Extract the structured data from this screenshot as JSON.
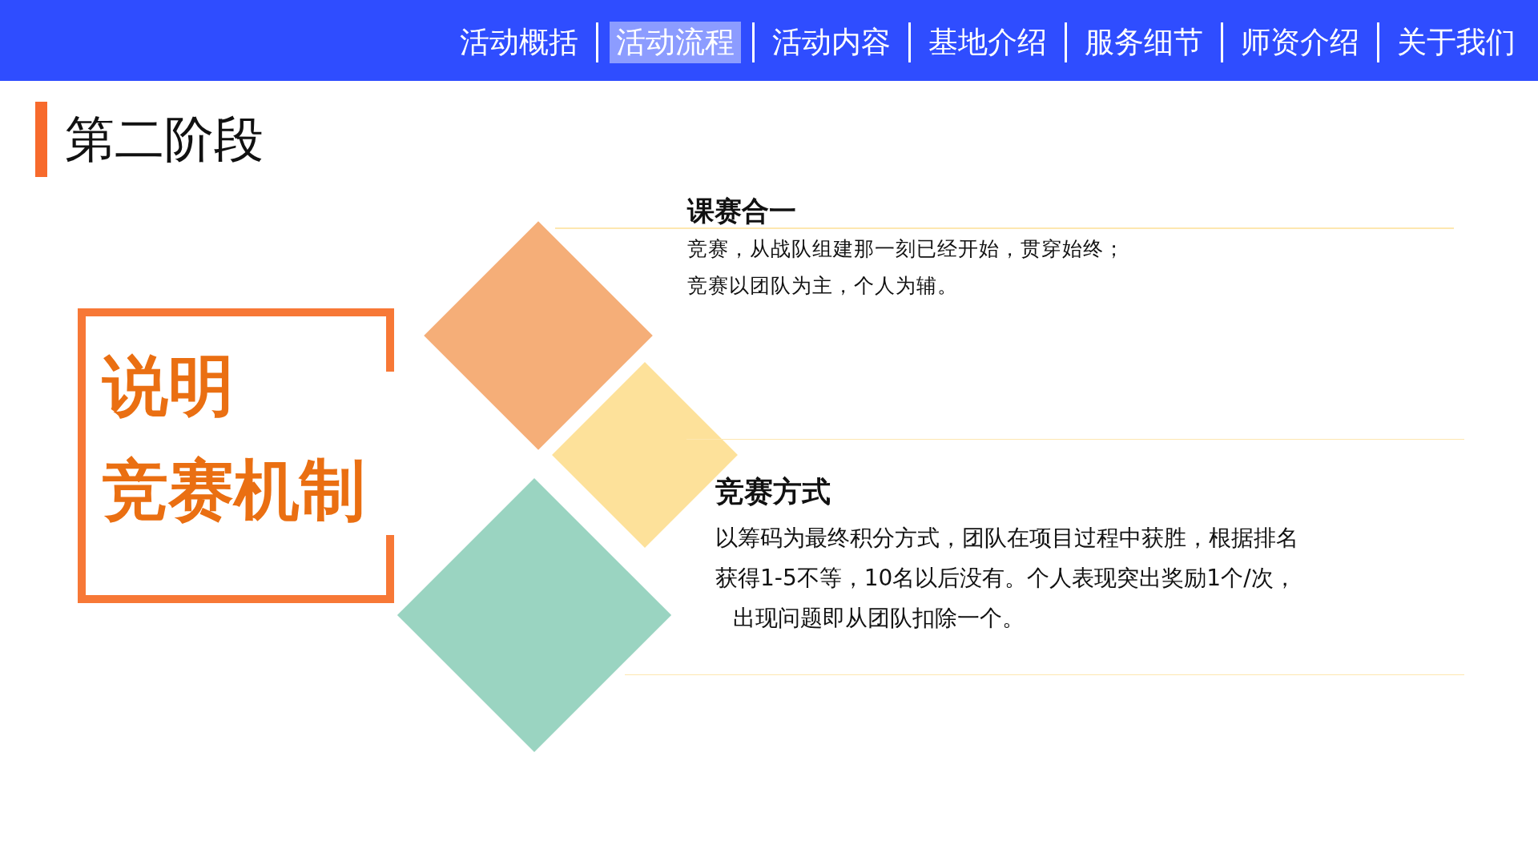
{
  "nav": {
    "items": [
      {
        "label": "活动概括",
        "selected": false
      },
      {
        "label": "活动流程",
        "selected": true
      },
      {
        "label": "活动内容",
        "selected": false
      },
      {
        "label": "基地介绍",
        "selected": false
      },
      {
        "label": "服务细节",
        "selected": false
      },
      {
        "label": "师资介绍",
        "selected": false
      },
      {
        "label": "关于我们",
        "selected": false
      }
    ]
  },
  "page_title": "第二阶段",
  "label_box": {
    "lines": [
      "说明",
      "竞赛机制"
    ]
  },
  "sections": [
    {
      "title": "课赛合一",
      "lines": [
        {
          "text": "竞赛，从战队组建那一刻已经开始，贯穿始终；",
          "indented": false
        },
        {
          "text": "竞赛以团队为主，个人为辅。",
          "indented": false
        }
      ]
    },
    {
      "title": "竞赛方式",
      "lines": [
        {
          "text": "以筹码为最终积分方式，团队在项目过程中获胜，根据排名",
          "indented": false
        },
        {
          "text": "获得1-5不等，10名以后没有。个人表现突出奖励1个/次，",
          "indented": false
        },
        {
          "text": "出现问题即从团队扣除一个。",
          "indented": true
        }
      ]
    }
  ]
}
